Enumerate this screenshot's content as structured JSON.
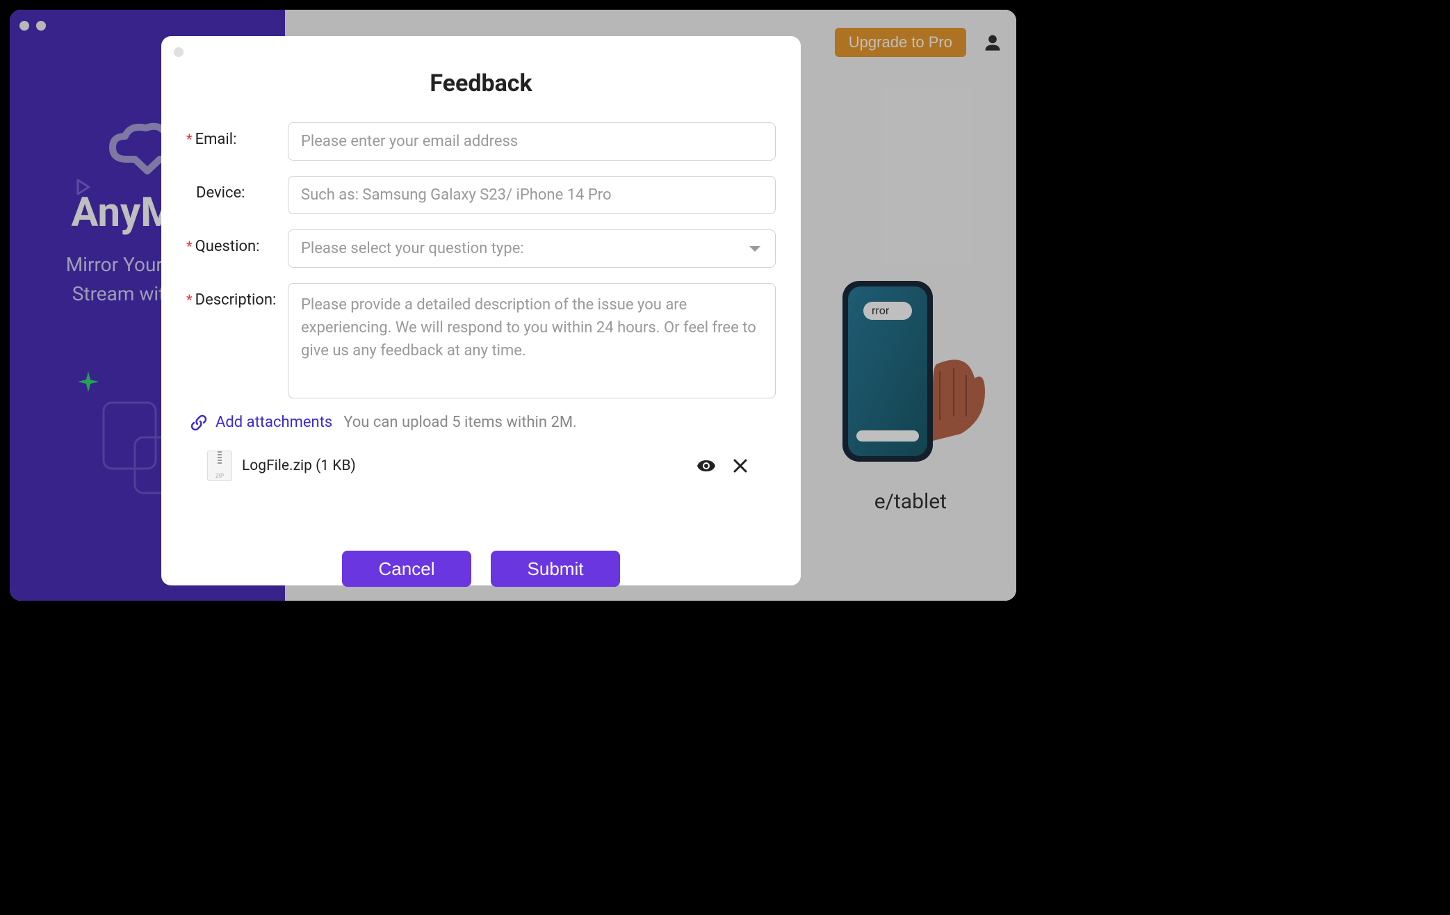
{
  "sidebar": {
    "title": "AnyMiro",
    "slogan_line1": "Mirror Your Device,",
    "slogan_line2": "Stream with Ease"
  },
  "topbar": {
    "upgrade_label": "Upgrade to Pro"
  },
  "main": {
    "device_text": "e/tablet"
  },
  "modal": {
    "title": "Feedback",
    "fields": {
      "email": {
        "label": "Email:",
        "placeholder": "Please enter your email address",
        "required": true
      },
      "device": {
        "label": "Device:",
        "placeholder": "Such as: Samsung Galaxy S23/ iPhone 14 Pro",
        "required": false
      },
      "question": {
        "label": "Question:",
        "placeholder": "Please select your question type:",
        "required": true
      },
      "description": {
        "label": "Description:",
        "placeholder": "Please provide a detailed description of the issue you are experiencing. We will respond to you within 24 hours. Or feel free to give us any feedback at any time.",
        "required": true
      }
    },
    "attachments": {
      "link_label": "Add attachments",
      "hint": "You can upload 5 items within 2M.",
      "files": [
        {
          "name": "LogFile.zip (1 KB)"
        }
      ]
    },
    "buttons": {
      "cancel": "Cancel",
      "submit": "Submit"
    }
  },
  "illustration": {
    "badge_text": "rror"
  }
}
